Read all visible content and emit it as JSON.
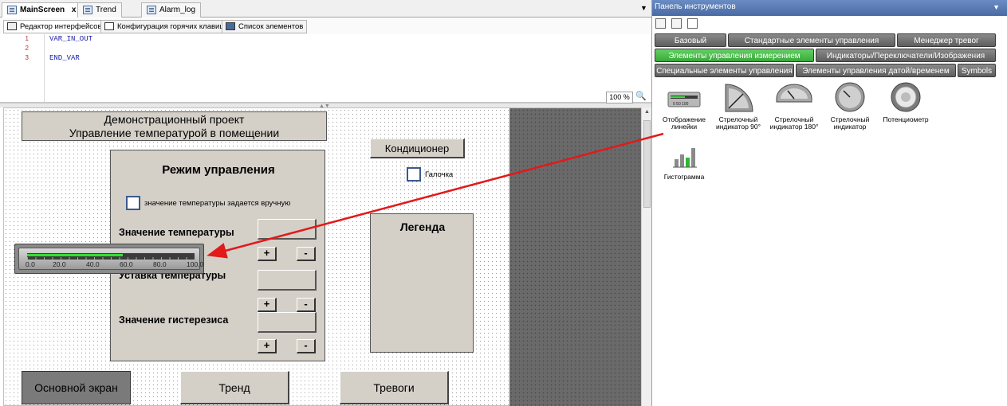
{
  "editor": {
    "tabs": [
      {
        "label": "MainScreen",
        "close": "x"
      },
      {
        "label": "Trend"
      },
      {
        "label": "Alarm_log"
      }
    ],
    "sub_tabs": [
      {
        "label": "Редактор интерфейсов"
      },
      {
        "label": "Конфигурация горячих клавиш"
      },
      {
        "label": "Список элементов"
      }
    ],
    "line_numbers": [
      "1",
      "2",
      "3"
    ],
    "code_lines": [
      "VAR_IN_OUT",
      "",
      "END_VAR"
    ],
    "zoom": "100 %"
  },
  "canvas": {
    "title_line1": "Демонстрационный проект",
    "title_line2": "Управление температурой в помещении",
    "aircon_button": "Кондиционер",
    "checkbox_tick_label": "Галочка",
    "mode_panel": {
      "title": "Режим управления",
      "manual_checkbox_label": "значение температуры задается вручную",
      "fields": [
        {
          "label": "Значение температуры"
        },
        {
          "label": "Уставка температуры"
        },
        {
          "label": "Значение гистерезиса"
        }
      ],
      "plus": "+",
      "minus": "-"
    },
    "legend_title": "Легенда",
    "nav_buttons": [
      "Основной экран",
      "Тренд",
      "Тревоги"
    ],
    "ruler": {
      "labels": [
        "0.0",
        "20.0",
        "40.0",
        "60.0",
        "80.0",
        "100.0"
      ],
      "fill_fraction": 0.57
    }
  },
  "toolbox": {
    "header": "Панель инструментов",
    "categories_row1": [
      "Базовый",
      "Стандартные элементы управления",
      "Менеджер тревог"
    ],
    "categories_row2": [
      "Элементы управления измерением",
      "Индикаторы/Переключатели/Изображения"
    ],
    "categories_row3": [
      "Специальные элементы управления",
      "Элементы управления датой/временем",
      "Symbols"
    ],
    "active_category": "Элементы управления измерением",
    "items": [
      {
        "label1": "Отображение",
        "label2": "линейки",
        "icon": "ruler-display-icon"
      },
      {
        "label1": "Стрелочный",
        "label2": "индикатор 90°",
        "icon": "gauge-90-icon"
      },
      {
        "label1": "Стрелочный",
        "label2": "индикатор 180°",
        "icon": "gauge-180-icon"
      },
      {
        "label1": "Стрелочный",
        "label2": "индикатор",
        "icon": "gauge-icon"
      },
      {
        "label1": "Потенциометр",
        "label2": "",
        "icon": "potentiometer-icon"
      },
      {
        "label1": "Гистограмма",
        "label2": "",
        "icon": "histogram-icon"
      }
    ]
  },
  "colors": {
    "accent_arrow": "#e21a1a",
    "active_category": "#3ba83b",
    "ruler_fill": "#34e034",
    "canvas_gray": "#6a6a6a"
  }
}
